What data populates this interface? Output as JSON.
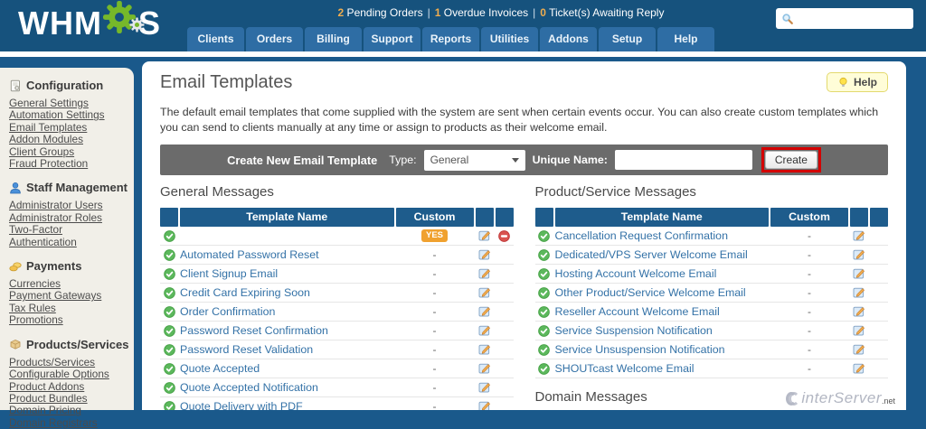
{
  "header": {
    "logo": {
      "part1": "WHM",
      "part2": "S"
    },
    "notifications": [
      {
        "count": "2",
        "label": "Pending Orders"
      },
      {
        "count": "1",
        "label": "Overdue Invoices"
      },
      {
        "count": "0",
        "label": "Ticket(s) Awaiting Reply"
      }
    ],
    "tabs": [
      "Clients",
      "Orders",
      "Billing",
      "Support",
      "Reports",
      "Utilities",
      "Addons",
      "Setup",
      "Help"
    ],
    "search": {
      "placeholder": ""
    }
  },
  "sidebar": {
    "sections": [
      {
        "title": "Configuration",
        "icon": "page-gear-icon",
        "links": [
          "General Settings",
          "Automation Settings",
          "Email Templates",
          "Addon Modules",
          "Client Groups",
          "Fraud Protection"
        ]
      },
      {
        "title": "Staff Management",
        "icon": "person-icon",
        "links": [
          "Administrator Users",
          "Administrator Roles",
          "Two-Factor Authentication"
        ]
      },
      {
        "title": "Payments",
        "icon": "coins-icon",
        "links": [
          "Currencies",
          "Payment Gateways",
          "Tax Rules",
          "Promotions"
        ]
      },
      {
        "title": "Products/Services",
        "icon": "box-icon",
        "links": [
          "Products/Services",
          "Configurable Options",
          "Product Addons",
          "Product Bundles",
          "Domain Pricing",
          "Domain Registrars"
        ]
      }
    ]
  },
  "main": {
    "title": "Email Templates",
    "help_button": "Help",
    "description": "The default email templates that come supplied with the system are sent when certain events occur. You can also create custom templates which you can send to clients manually at any time or assign to products as their welcome email.",
    "create_bar": {
      "title": "Create New Email Template",
      "type_label": "Type:",
      "type_value": "General",
      "unique_name_label": "Unique Name:",
      "unique_name_value": "",
      "create_button": "Create"
    },
    "tables": [
      {
        "heading": "General Messages",
        "columns": {
          "name": "Template Name",
          "custom": "Custom"
        },
        "rows": [
          {
            "name": "",
            "custom": "YES",
            "delete": true
          },
          {
            "name": "Automated Password Reset",
            "custom": "-"
          },
          {
            "name": "Client Signup Email",
            "custom": "-"
          },
          {
            "name": "Credit Card Expiring Soon",
            "custom": "-"
          },
          {
            "name": "Order Confirmation",
            "custom": "-"
          },
          {
            "name": "Password Reset Confirmation",
            "custom": "-"
          },
          {
            "name": "Password Reset Validation",
            "custom": "-"
          },
          {
            "name": "Quote Accepted",
            "custom": "-"
          },
          {
            "name": "Quote Accepted Notification",
            "custom": "-"
          },
          {
            "name": "Quote Delivery with PDF",
            "custom": "-"
          }
        ]
      },
      {
        "heading": "Product/Service Messages",
        "columns": {
          "name": "Template Name",
          "custom": "Custom"
        },
        "rows": [
          {
            "name": "Cancellation Request Confirmation",
            "custom": "-"
          },
          {
            "name": "Dedicated/VPS Server Welcome Email",
            "custom": "-"
          },
          {
            "name": "Hosting Account Welcome Email",
            "custom": "-"
          },
          {
            "name": "Other Product/Service Welcome Email",
            "custom": "-"
          },
          {
            "name": "Reseller Account Welcome Email",
            "custom": "-"
          },
          {
            "name": "Service Suspension Notification",
            "custom": "-"
          },
          {
            "name": "Service Unsuspension Notification",
            "custom": "-"
          },
          {
            "name": "SHOUTcast Welcome Email",
            "custom": "-"
          }
        ]
      }
    ],
    "next_section_heading": "Domain Messages",
    "watermark": {
      "text": "interServer",
      "tld": ".net"
    }
  },
  "colors": {
    "header_bg": "#16527d",
    "tab_bg": "#2e6da4",
    "body_bg": "#1a598b",
    "sidebar_bg": "#f1efe8",
    "table_header_bg": "#1e5c8c",
    "yes_badge": "#f0a12f",
    "annotation_red": "#d40000",
    "help_bg": "#fffdd8",
    "link_blue": "#3472a7",
    "count_orange": "#f0ad4e"
  }
}
